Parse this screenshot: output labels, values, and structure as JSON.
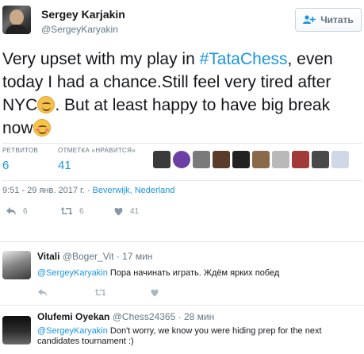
{
  "tweet": {
    "author_name": "Sergey Karjakin",
    "author_handle": "@SergeyKaryakin",
    "follow_label": "Читать",
    "text_part1": "Very upset with my play in ",
    "hashtag": "#TataChess",
    "text_part2": ", even today I had a chance.Still feel very tired after NYC",
    "text_part3": ". But at least happy to have big break now",
    "stats": {
      "retweets_label": "РЕТВИТОВ",
      "retweets_value": "6",
      "likes_label": "ОТМЕТКА «НРАВИТСЯ»",
      "likes_value": "41"
    },
    "timestamp": "9:51 - 29 янв. 2017 г.",
    "location": "Beverwijk, Nederland",
    "actions": {
      "reply_count": "6",
      "retweet_count": "6",
      "like_count": "41"
    }
  },
  "replies": [
    {
      "name": "Vitali",
      "handle": "@Boger_Vit",
      "time": "· 17 мин",
      "mention": "@SergeyKaryakin",
      "text": " Пора начинать играть. Ждём ярких побед"
    },
    {
      "name": "Olufemi Oyekan",
      "handle": "@Chess24365",
      "time": "· 28 мин",
      "mention": "@SergeyKaryakin",
      "text": " Don't worry, we know you were hiding prep for the next",
      "text2": "candidates tournament :)"
    }
  ],
  "colors": {
    "link": "#1b95e0",
    "muted": "#657786",
    "icon": "#8899a6",
    "divider": "#e1e8ed"
  },
  "icons": [
    "add-user-icon",
    "reply-icon",
    "retweet-icon",
    "heart-icon"
  ]
}
